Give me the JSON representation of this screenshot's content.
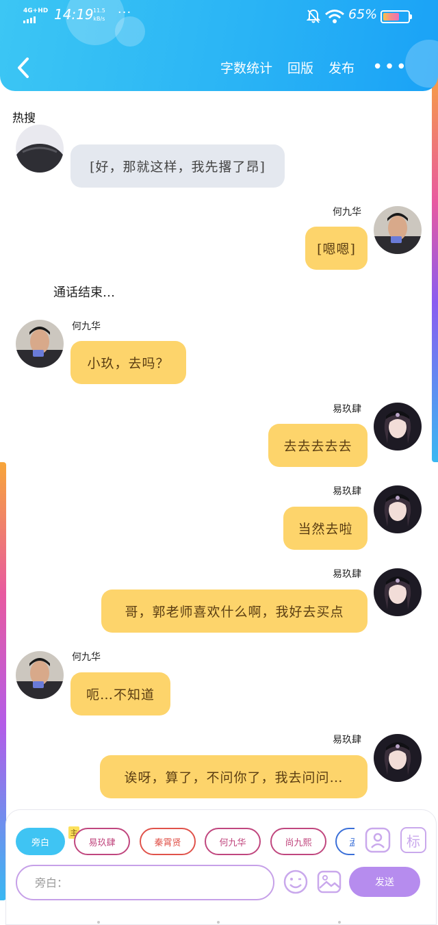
{
  "status_bar": {
    "network": "4G+HD",
    "time": "14:19",
    "speed_value": "11.5",
    "speed_unit": "kB/s",
    "battery_percent": "65%",
    "battery_level": 0.65
  },
  "header": {
    "actions": [
      "字数统计",
      "回版",
      "发布"
    ]
  },
  "hot_search_label": "热搜",
  "messages": [
    {
      "name": "",
      "text": "[好，那就这样，我先撂了昂]"
    },
    {
      "name": "何九华",
      "text": "[嗯嗯]"
    },
    {
      "system": "通话结束…"
    },
    {
      "name": "何九华",
      "text": "小玖，去吗？"
    },
    {
      "name": "易玖肆",
      "text": "去去去去去"
    },
    {
      "name": "易玖肆",
      "text": "当然去啦"
    },
    {
      "name": "易玖肆",
      "text": "哥，郭老师喜欢什么啊，我好去买点"
    },
    {
      "name": "何九华",
      "text": "呃…不知道"
    },
    {
      "name": "易玖肆",
      "text": "诶呀，算了，不问你了，我去问问…"
    }
  ],
  "composer": {
    "roles": [
      {
        "label": "旁白",
        "color": "#3fc4f3"
      },
      {
        "label": "易玖肆",
        "color": "#c0467e"
      },
      {
        "label": "秦霄贤",
        "color": "#e0524a"
      },
      {
        "label": "何九华",
        "color": "#c0467e"
      },
      {
        "label": "尚九熙",
        "color": "#c0467e"
      },
      {
        "label": "孟",
        "color": "#3a6fd8"
      }
    ],
    "main_tag": "主",
    "input_placeholder": "旁白：",
    "send_label": "发送",
    "tag_button_label": "标"
  }
}
